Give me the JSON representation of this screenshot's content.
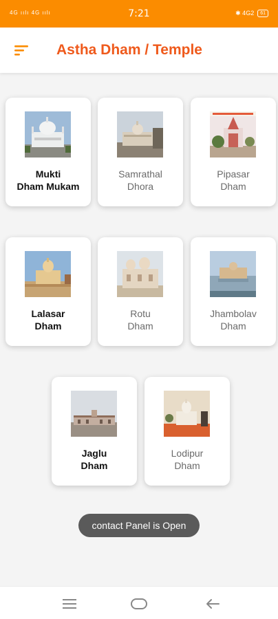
{
  "status_bar": {
    "left_text": "4G ıılı 4G ıılı",
    "time": "7:21",
    "right_text": "✱ 4G2",
    "battery": "61"
  },
  "header": {
    "title": "Astha Dham / Temple",
    "menu_icon": "sort-menu-icon"
  },
  "cards": [
    {
      "label": "Mukti\nDham Mukam",
      "icon": "temple-image"
    },
    {
      "label": "Samrathal\nDhora",
      "icon": "temple-image"
    },
    {
      "label": "Pipasar\nDham",
      "icon": "temple-image"
    },
    {
      "label": "Lalasar\nDham",
      "icon": "temple-image"
    },
    {
      "label": "Rotu\nDham",
      "icon": "temple-image"
    },
    {
      "label": "Jhambolav\nDham",
      "icon": "temple-image"
    },
    {
      "label": "Jaglu\nDham",
      "icon": "temple-image"
    },
    {
      "label": "Lodipur\nDham",
      "icon": "temple-image"
    }
  ],
  "toast": "contact Panel is Open",
  "nav": {
    "menu_icon": "recent-apps-icon",
    "home_icon": "home-icon",
    "back_icon": "back-icon"
  },
  "colors": {
    "status_bar": "#fb8c00",
    "title": "#ef5a1c",
    "background": "#f4f4f4",
    "toast": "#5a5a5a"
  }
}
